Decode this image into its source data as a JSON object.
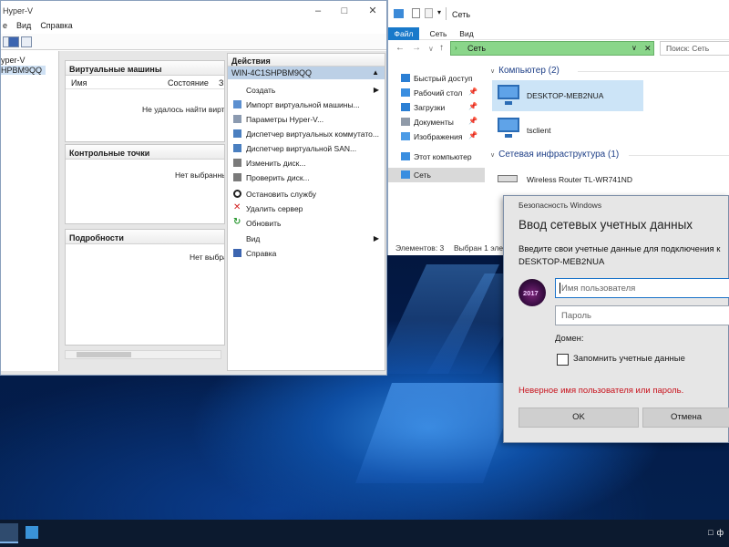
{
  "hyperv": {
    "title": "Hyper-V",
    "menu": [
      "е",
      "Вид",
      "Справка"
    ],
    "tree": [
      "yper-V",
      "HPBM9QQ"
    ],
    "vm_panel": {
      "header": "Виртуальные машины",
      "columns": [
        "Имя",
        "Состояние",
        "З"
      ],
      "message": "Не удалось найти виртуал"
    },
    "checkpoints_panel": {
      "header": "Контрольные точки",
      "message": "Нет выбранных"
    },
    "details_panel": {
      "header": "Подробности",
      "message": "Нет выбран"
    },
    "actions": {
      "header": "Действия",
      "selected": "WIN-4C1SHPBM9QQ",
      "items": [
        {
          "label": "Создать",
          "icon": "blank-icon",
          "submenu": true
        },
        {
          "label": "Импорт виртуальной машины...",
          "icon": "import-icon"
        },
        {
          "label": "Параметры Hyper-V...",
          "icon": "settings-doc-icon"
        },
        {
          "label": "Диспетчер виртуальных коммутато...",
          "icon": "switch-manager-icon"
        },
        {
          "label": "Диспетчер виртуальной SAN...",
          "icon": "san-manager-icon"
        },
        {
          "label": "Изменить диск...",
          "icon": "edit-disk-icon"
        },
        {
          "label": "Проверить диск...",
          "icon": "inspect-disk-icon"
        },
        {
          "label": "Остановить службу",
          "icon": "stop-service-icon"
        },
        {
          "label": "Удалить сервер",
          "icon": "remove-server-icon"
        },
        {
          "label": "Обновить",
          "icon": "refresh-icon"
        },
        {
          "label": "Вид",
          "icon": "blank-icon",
          "submenu": true
        },
        {
          "label": "Справка",
          "icon": "help-icon"
        }
      ]
    }
  },
  "explorer": {
    "title": "Сеть",
    "ribbon_tabs": [
      "Файл",
      "Сеть",
      "Вид"
    ],
    "address": "Сеть",
    "search_placeholder": "Поиск: Сеть",
    "nav": [
      {
        "label": "Быстрый доступ",
        "icon": "star-icon"
      },
      {
        "label": "Рабочий стол",
        "icon": "desktop-folder-icon",
        "pinned": true
      },
      {
        "label": "Загрузки",
        "icon": "downloads-icon",
        "pinned": true
      },
      {
        "label": "Документы",
        "icon": "documents-icon",
        "pinned": true
      },
      {
        "label": "Изображения",
        "icon": "pictures-icon",
        "pinned": true
      },
      {
        "label": "Этот компьютер",
        "icon": "this-pc-icon"
      },
      {
        "label": "Сеть",
        "icon": "network-icon",
        "selected": true
      }
    ],
    "groups": {
      "computers": {
        "label": "Компьютер (2)",
        "items": [
          "DESKTOP-MEB2NUA",
          "tsclient"
        ]
      },
      "infrastructure": {
        "label": "Сетевая инфраструктура (1)",
        "items": [
          "Wireless Router TL-WR741ND"
        ]
      }
    },
    "status": {
      "count": "Элементов: 3",
      "selected": "Выбран 1 элем"
    }
  },
  "credential_dialog": {
    "caption": "Безопасность Windows",
    "title": "Ввод сетевых учетных данных",
    "description_line1": "Введите свои учетные данные для подключения к",
    "description_line2": "DESKTOP-MEB2NUA",
    "avatar_text": "2017",
    "username_placeholder": "Имя пользователя",
    "password_placeholder": "Пароль",
    "domain_label": "Домен:",
    "remember_label": "Запомнить учетные данные",
    "error": "Неверное имя пользователя или пароль.",
    "ok": "OK",
    "cancel": "Отмена"
  },
  "taskbar": {
    "tray_text": "ф"
  },
  "colors": {
    "accent": "#1979ca",
    "error": "#c8141e",
    "address_bar": "#8ad68a",
    "selection": "#cce4f7"
  }
}
